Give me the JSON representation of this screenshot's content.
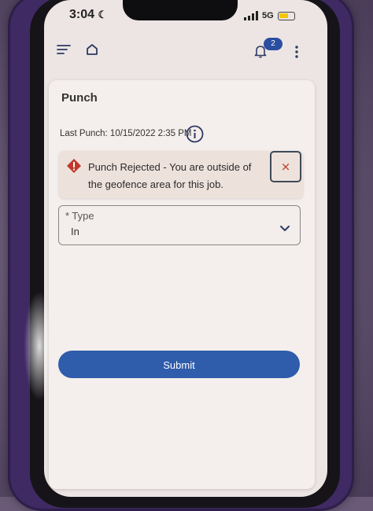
{
  "status_bar": {
    "time": "3:04",
    "network": "5G"
  },
  "header": {
    "notification_count": "2"
  },
  "punch": {
    "title": "Punch",
    "last_punch": "Last Punch: 10/15/2022 2:35 PM"
  },
  "alert": {
    "message": "Punch Rejected - You are outside of the geofence area for this job.",
    "close_symbol": "×"
  },
  "type_select": {
    "label": "* Type",
    "value": "In"
  },
  "submit": {
    "label": "Submit"
  },
  "colors": {
    "accent": "#2f5cab",
    "alert_icon": "#c0392b",
    "case": "#3f2a63"
  }
}
